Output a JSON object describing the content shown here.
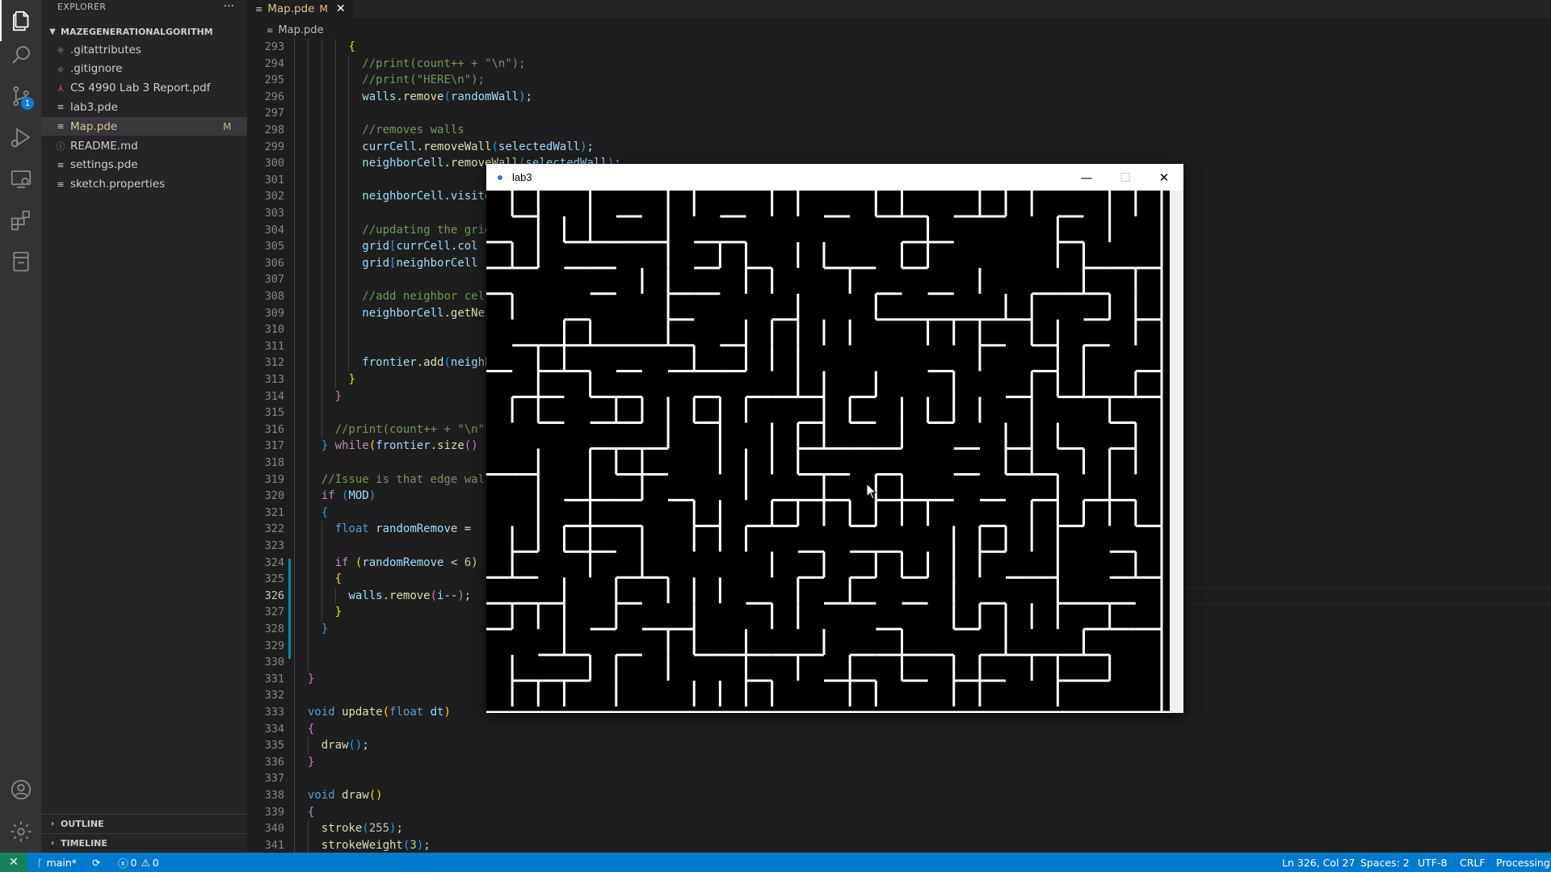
{
  "activity_bar": {
    "items": [
      "explorer-icon",
      "search-icon",
      "source-control-icon",
      "run-debug-icon",
      "remote-explorer-icon",
      "extensions-icon",
      "testing-icon",
      "account-icon",
      "settings-gear-icon"
    ],
    "source_control_badge": "1"
  },
  "sidebar": {
    "title": "EXPLORER",
    "more": "···",
    "folder": "MAZEGENERATIONALGORITHM",
    "files": [
      {
        "icon": "◆",
        "name": ".gitattributes",
        "status": ""
      },
      {
        "icon": "◆",
        "name": ".gitignore",
        "status": ""
      },
      {
        "icon": "⅄",
        "name": "CS 4990 Lab 3 Report.pdf",
        "status": ""
      },
      {
        "icon": "≡",
        "name": "lab3.pde",
        "status": ""
      },
      {
        "icon": "≡",
        "name": "Map.pde",
        "status": "M"
      },
      {
        "icon": "ⓘ",
        "name": "README.md",
        "status": ""
      },
      {
        "icon": "≡",
        "name": "settings.pde",
        "status": ""
      },
      {
        "icon": "≡",
        "name": "sketch.properties",
        "status": ""
      }
    ],
    "outline": "OUTLINE",
    "timeline": "TIMELINE"
  },
  "tabs": {
    "active": {
      "label": "Map.pde",
      "modified": "M",
      "close": "✕"
    }
  },
  "breadcrumb": "Map.pde",
  "editor": {
    "current_line": 326,
    "lines": [
      {
        "n": 293,
        "indent": 4,
        "tokens": [
          [
            "c-b1",
            "{"
          ]
        ]
      },
      {
        "n": 294,
        "indent": 5,
        "tokens": [
          [
            "c-cm",
            "//print(count++ + \"\\n\");"
          ]
        ]
      },
      {
        "n": 295,
        "indent": 5,
        "tokens": [
          [
            "c-cm",
            "//print(\"HERE\\n\");"
          ]
        ]
      },
      {
        "n": 296,
        "indent": 5,
        "tokens": [
          [
            "c-var",
            "walls"
          ],
          [
            "",
            "."
          ],
          [
            "c-fn",
            "remove"
          ],
          [
            "c-b3",
            "("
          ],
          [
            "c-var",
            "randomWall"
          ],
          [
            "c-b3",
            ")"
          ],
          [
            "",
            ";"
          ]
        ]
      },
      {
        "n": 297,
        "indent": 5,
        "tokens": []
      },
      {
        "n": 298,
        "indent": 5,
        "tokens": [
          [
            "c-cm",
            "//removes walls"
          ]
        ]
      },
      {
        "n": 299,
        "indent": 5,
        "tokens": [
          [
            "c-var",
            "currCell"
          ],
          [
            "",
            "."
          ],
          [
            "c-fn",
            "removeWall"
          ],
          [
            "c-b3",
            "("
          ],
          [
            "c-var",
            "selectedWall"
          ],
          [
            "c-b3",
            ")"
          ],
          [
            "",
            ";"
          ]
        ]
      },
      {
        "n": 300,
        "indent": 5,
        "tokens": [
          [
            "c-var",
            "neighborCell"
          ],
          [
            "",
            "."
          ],
          [
            "c-fn",
            "removeWall"
          ],
          [
            "c-b3",
            "("
          ],
          [
            "c-var",
            "selectedWall"
          ],
          [
            "c-b3",
            ")"
          ],
          [
            "",
            ";"
          ]
        ]
      },
      {
        "n": 301,
        "indent": 5,
        "tokens": []
      },
      {
        "n": 302,
        "indent": 5,
        "tokens": [
          [
            "c-var",
            "neighborCell"
          ],
          [
            "",
            "."
          ],
          [
            "c-var",
            "visited"
          ]
        ]
      },
      {
        "n": 303,
        "indent": 5,
        "tokens": []
      },
      {
        "n": 304,
        "indent": 5,
        "tokens": [
          [
            "c-cm",
            "//updating the grid"
          ]
        ]
      },
      {
        "n": 305,
        "indent": 5,
        "tokens": [
          [
            "c-var",
            "grid"
          ],
          [
            "c-b3",
            "["
          ],
          [
            "c-var",
            "currCell"
          ],
          [
            "",
            "."
          ],
          [
            "c-var",
            "col"
          ]
        ]
      },
      {
        "n": 306,
        "indent": 5,
        "tokens": [
          [
            "c-var",
            "grid"
          ],
          [
            "c-b3",
            "["
          ],
          [
            "c-var",
            "neighborCell"
          ]
        ]
      },
      {
        "n": 307,
        "indent": 5,
        "tokens": []
      },
      {
        "n": 308,
        "indent": 5,
        "tokens": [
          [
            "c-cm",
            "//add neighbor cells"
          ]
        ]
      },
      {
        "n": 309,
        "indent": 5,
        "tokens": [
          [
            "c-var",
            "neighborCell"
          ],
          [
            "",
            "."
          ],
          [
            "c-fn",
            "getNeighbors"
          ]
        ]
      },
      {
        "n": 310,
        "indent": 5,
        "tokens": []
      },
      {
        "n": 311,
        "indent": 5,
        "tokens": []
      },
      {
        "n": 312,
        "indent": 5,
        "tokens": [
          [
            "c-var",
            "frontier"
          ],
          [
            "",
            "."
          ],
          [
            "c-fn",
            "add"
          ],
          [
            "c-b3",
            "("
          ],
          [
            "c-var",
            "neighbors"
          ]
        ]
      },
      {
        "n": 313,
        "indent": 4,
        "tokens": [
          [
            "c-b1",
            "}"
          ]
        ]
      },
      {
        "n": 314,
        "indent": 3,
        "tokens": [
          [
            "c-b2",
            "}"
          ]
        ]
      },
      {
        "n": 315,
        "indent": 3,
        "tokens": []
      },
      {
        "n": 316,
        "indent": 3,
        "tokens": [
          [
            "c-cm",
            "//print(count++ + \"\\n\");"
          ]
        ]
      },
      {
        "n": 317,
        "indent": 2,
        "tokens": [
          [
            "c-b3",
            "}"
          ],
          [
            "",
            " "
          ],
          [
            "c-ctl",
            "while"
          ],
          [
            "c-b1",
            "("
          ],
          [
            "c-var",
            "frontier"
          ],
          [
            "",
            "."
          ],
          [
            "c-fn",
            "size"
          ],
          [
            "c-b2",
            "("
          ],
          [
            "c-b2",
            ")"
          ]
        ]
      },
      {
        "n": 318,
        "indent": 2,
        "tokens": []
      },
      {
        "n": 319,
        "indent": 2,
        "tokens": [
          [
            "c-cm",
            "//Issue is that edge walls"
          ]
        ]
      },
      {
        "n": 320,
        "indent": 2,
        "tokens": [
          [
            "c-ctl",
            "if"
          ],
          [
            "",
            " "
          ],
          [
            "c-b3",
            "("
          ],
          [
            "c-var",
            "MOD"
          ],
          [
            "c-b3",
            ")"
          ]
        ]
      },
      {
        "n": 321,
        "indent": 2,
        "tokens": [
          [
            "c-b3",
            "{"
          ]
        ]
      },
      {
        "n": 322,
        "indent": 3,
        "tokens": [
          [
            "c-kw",
            "float"
          ],
          [
            "",
            " "
          ],
          [
            "c-var",
            "randomRemove"
          ],
          [
            "",
            " = "
          ]
        ]
      },
      {
        "n": 323,
        "indent": 3,
        "tokens": []
      },
      {
        "n": 324,
        "indent": 3,
        "tokens": [
          [
            "c-ctl",
            "if"
          ],
          [
            "",
            " "
          ],
          [
            "c-b1",
            "("
          ],
          [
            "c-var",
            "randomRemove"
          ],
          [
            "",
            " < "
          ],
          [
            "c-num",
            "6"
          ],
          [
            "c-b1",
            ")"
          ]
        ]
      },
      {
        "n": 325,
        "indent": 3,
        "tokens": [
          [
            "c-b1",
            "{"
          ]
        ]
      },
      {
        "n": 326,
        "indent": 4,
        "tokens": [
          [
            "c-var",
            "walls"
          ],
          [
            "",
            "."
          ],
          [
            "c-fn",
            "remove"
          ],
          [
            "c-b2",
            "("
          ],
          [
            "c-var",
            "i"
          ],
          [
            "",
            "--"
          ],
          [
            "c-b2",
            ")"
          ],
          [
            "",
            ";"
          ]
        ]
      },
      {
        "n": 327,
        "indent": 3,
        "tokens": [
          [
            "c-b1",
            "}"
          ]
        ]
      },
      {
        "n": 328,
        "indent": 2,
        "tokens": [
          [
            "c-b3",
            "}"
          ]
        ]
      },
      {
        "n": 329,
        "indent": 2,
        "tokens": []
      },
      {
        "n": 330,
        "indent": 2,
        "tokens": []
      },
      {
        "n": 331,
        "indent": 1,
        "tokens": [
          [
            "c-b2",
            "}"
          ]
        ]
      },
      {
        "n": 332,
        "indent": 1,
        "tokens": []
      },
      {
        "n": 333,
        "indent": 1,
        "tokens": [
          [
            "c-kw",
            "void"
          ],
          [
            "",
            " "
          ],
          [
            "c-fn",
            "update"
          ],
          [
            "c-b1",
            "("
          ],
          [
            "c-kw",
            "float"
          ],
          [
            "",
            " "
          ],
          [
            "c-var",
            "dt"
          ],
          [
            "c-b1",
            ")"
          ]
        ]
      },
      {
        "n": 334,
        "indent": 1,
        "tokens": [
          [
            "c-b2",
            "{"
          ]
        ]
      },
      {
        "n": 335,
        "indent": 2,
        "tokens": [
          [
            "c-fn",
            "draw"
          ],
          [
            "c-b3",
            "("
          ],
          [
            "c-b3",
            ")"
          ],
          [
            "",
            ";"
          ]
        ]
      },
      {
        "n": 336,
        "indent": 1,
        "tokens": [
          [
            "c-b2",
            "}"
          ]
        ]
      },
      {
        "n": 337,
        "indent": 1,
        "tokens": []
      },
      {
        "n": 338,
        "indent": 1,
        "tokens": [
          [
            "c-kw",
            "void"
          ],
          [
            "",
            " "
          ],
          [
            "c-fn",
            "draw"
          ],
          [
            "c-b1",
            "("
          ],
          [
            "c-b1",
            ")"
          ]
        ]
      },
      {
        "n": 339,
        "indent": 1,
        "tokens": [
          [
            "c-b2",
            "{"
          ]
        ]
      },
      {
        "n": 340,
        "indent": 2,
        "tokens": [
          [
            "c-fn",
            "stroke"
          ],
          [
            "c-b3",
            "("
          ],
          [
            "c-num",
            "255"
          ],
          [
            "c-b3",
            ")"
          ],
          [
            "",
            ";"
          ]
        ]
      },
      {
        "n": 341,
        "indent": 2,
        "tokens": [
          [
            "c-fn",
            "strokeWeight"
          ],
          [
            "c-b3",
            "("
          ],
          [
            "c-num",
            "3"
          ],
          [
            "c-b3",
            ")"
          ],
          [
            "",
            ";"
          ]
        ]
      }
    ]
  },
  "sketch_window": {
    "title": "lab3",
    "minimize": "—",
    "maximize": "☐",
    "close": "✕",
    "maze": {
      "cols": 26,
      "rows": 20,
      "wall_color": "#ffffff",
      "bg_color": "#000000"
    }
  },
  "status_bar": {
    "remote": "✕",
    "branch": "main*",
    "sync": "⟳",
    "errors": "0",
    "warnings": "0",
    "position": "Ln 326, Col 27",
    "spaces": "Spaces: 2",
    "encoding": "UTF-8",
    "eol": "CRLF",
    "language": "Processing"
  }
}
